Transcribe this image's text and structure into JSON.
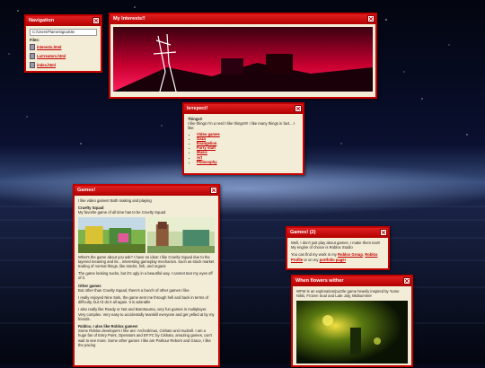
{
  "navigation": {
    "title": "Navigation",
    "path": "C:/Users/FlameSignaSite",
    "files_label": "Files:",
    "files": [
      "interests.html",
      "LaCreators.html",
      "index.html"
    ]
  },
  "interests": {
    "title": "My Interests!!"
  },
  "small": {
    "title": "Інтересі!",
    "heading": "Things!!",
    "intro": "I like things I'm a nerd I like things!!!! I like many things in fact... I like:",
    "items": [
      "Video games",
      "Gaza",
      "Evangelion",
      "Furry stuff",
      "Music",
      "Art",
      "Philosophy"
    ]
  },
  "games": {
    "title": "Games!",
    "intro": "I like video games! Both making and playing",
    "cs_heading": "Cruelty Squad",
    "cs_text": "My favorite game of all time has to be Cruelty Squad",
    "cs_p2": "What's the game about you ask? I have no idea! I like Cruelty Squad due to the layered meaning and its... interesting gameplay mechanics. Such as stock market trading of normal things, like stocks, fish, and organs",
    "cs_p3": "The game looking sucks, but it's ugly in a beautiful way. I cannot tear my eyes off of it.",
    "og_heading": "Other games",
    "og_text": "But other than Cruelty Squad, there's a bunch of other games I like",
    "og_p2": "I really enjoyed Nine Sols, the game sent me through hell and back in terms of difficulty, but I'd do it all again. It is adorable",
    "og_p3": "I also really like Ready or Not and Barotrauma, very fun games in multiplayer. Very complex. Very easy to accidentally teamkill everyone and get yelled at by my friends.",
    "rb_heading": "Roblox, I also like Roblox games!",
    "rb_text": "Some Roblox developers I like are: Archedrinus, Cishato and Hudzell. I am a huge fan of Entry Point, Operators and EF:FC by Cishato, amazing games, can't wait to see more. Some other games I like are Parkour Reborn and Grace, I like the pacing"
  },
  "games2": {
    "title": "Games! (2)",
    "p1": "Well, I don't just play about games, I make them too!!! My engine of choice is Roblox Studio",
    "p2_prefix": "You can find my work in my",
    "link1": "Roblox Group",
    "link2": "Roblox Profile",
    "p2_mid": "or on my",
    "link3": "portfolio page!"
  },
  "flowers": {
    "title": "When flowers wither",
    "text": "WFW is an exploration/puzzle game heavily inspired by Yume Nikki, Frozen Soul and Late July, Midsummer"
  },
  "colors": {
    "accent": "#c40000",
    "window_bg": "#f3ecd6"
  }
}
